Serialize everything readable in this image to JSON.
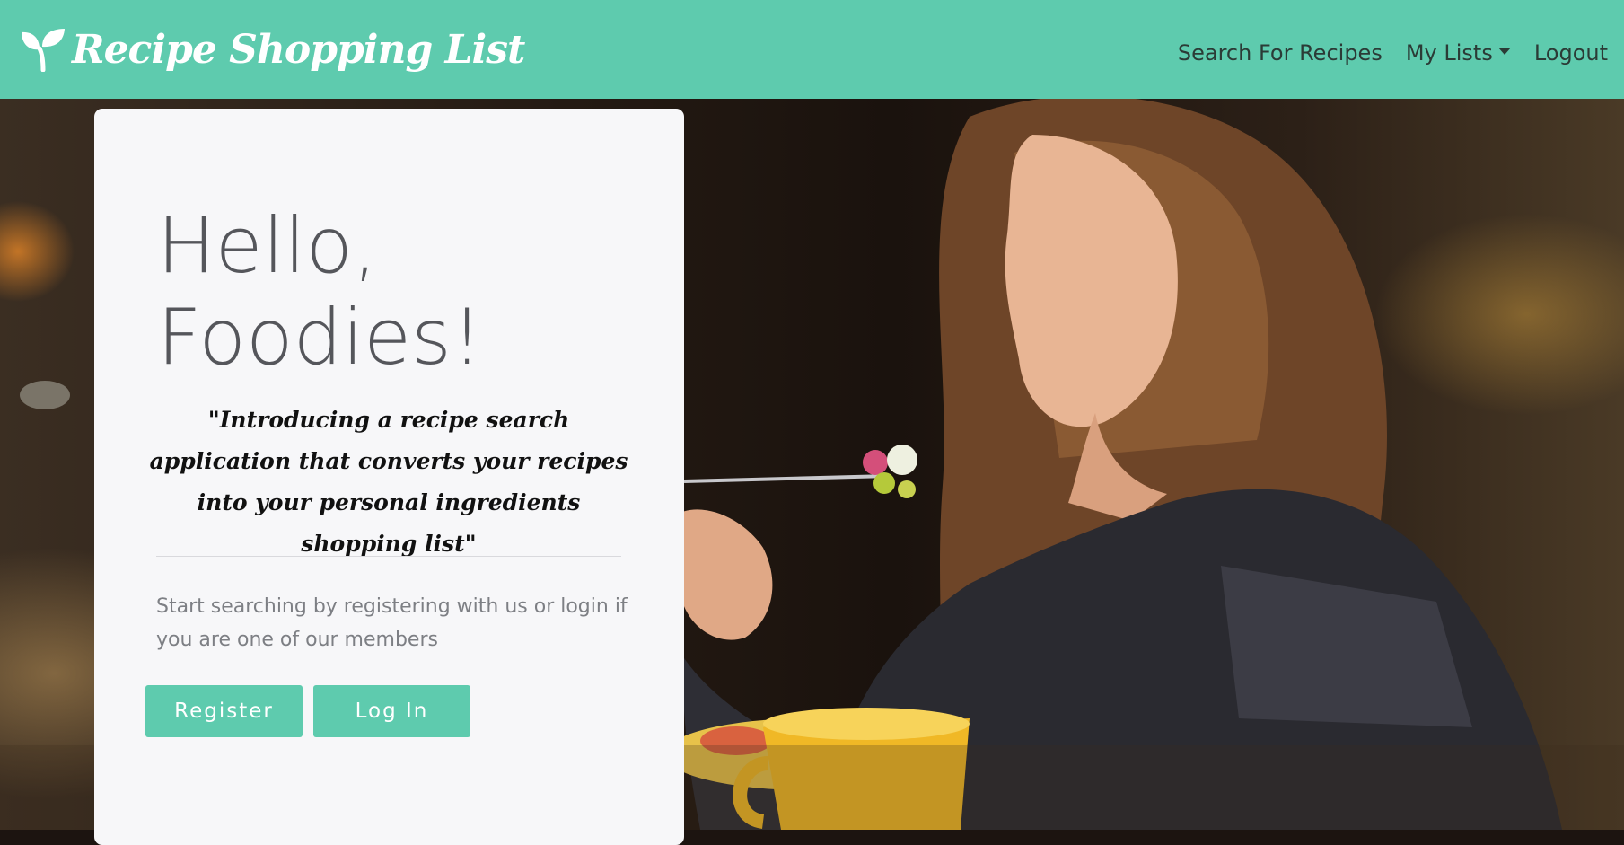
{
  "navbar": {
    "brand": "Recipe Shopping List",
    "links": {
      "search": "Search For Recipes",
      "my_lists": "My Lists",
      "logout": "Logout"
    },
    "background_color": "#5ecbae"
  },
  "hero": {
    "title_line1": "Hello,",
    "title_line2": "Foodies!",
    "quote": "\"Introducing a recipe search application that converts your recipes into your personal ingredients shopping list\"",
    "lead": "Start searching by registering with us or login if you are one of our members",
    "buttons": {
      "register": "Register",
      "login": "Log In"
    },
    "accent_color": "#5ecbae"
  }
}
